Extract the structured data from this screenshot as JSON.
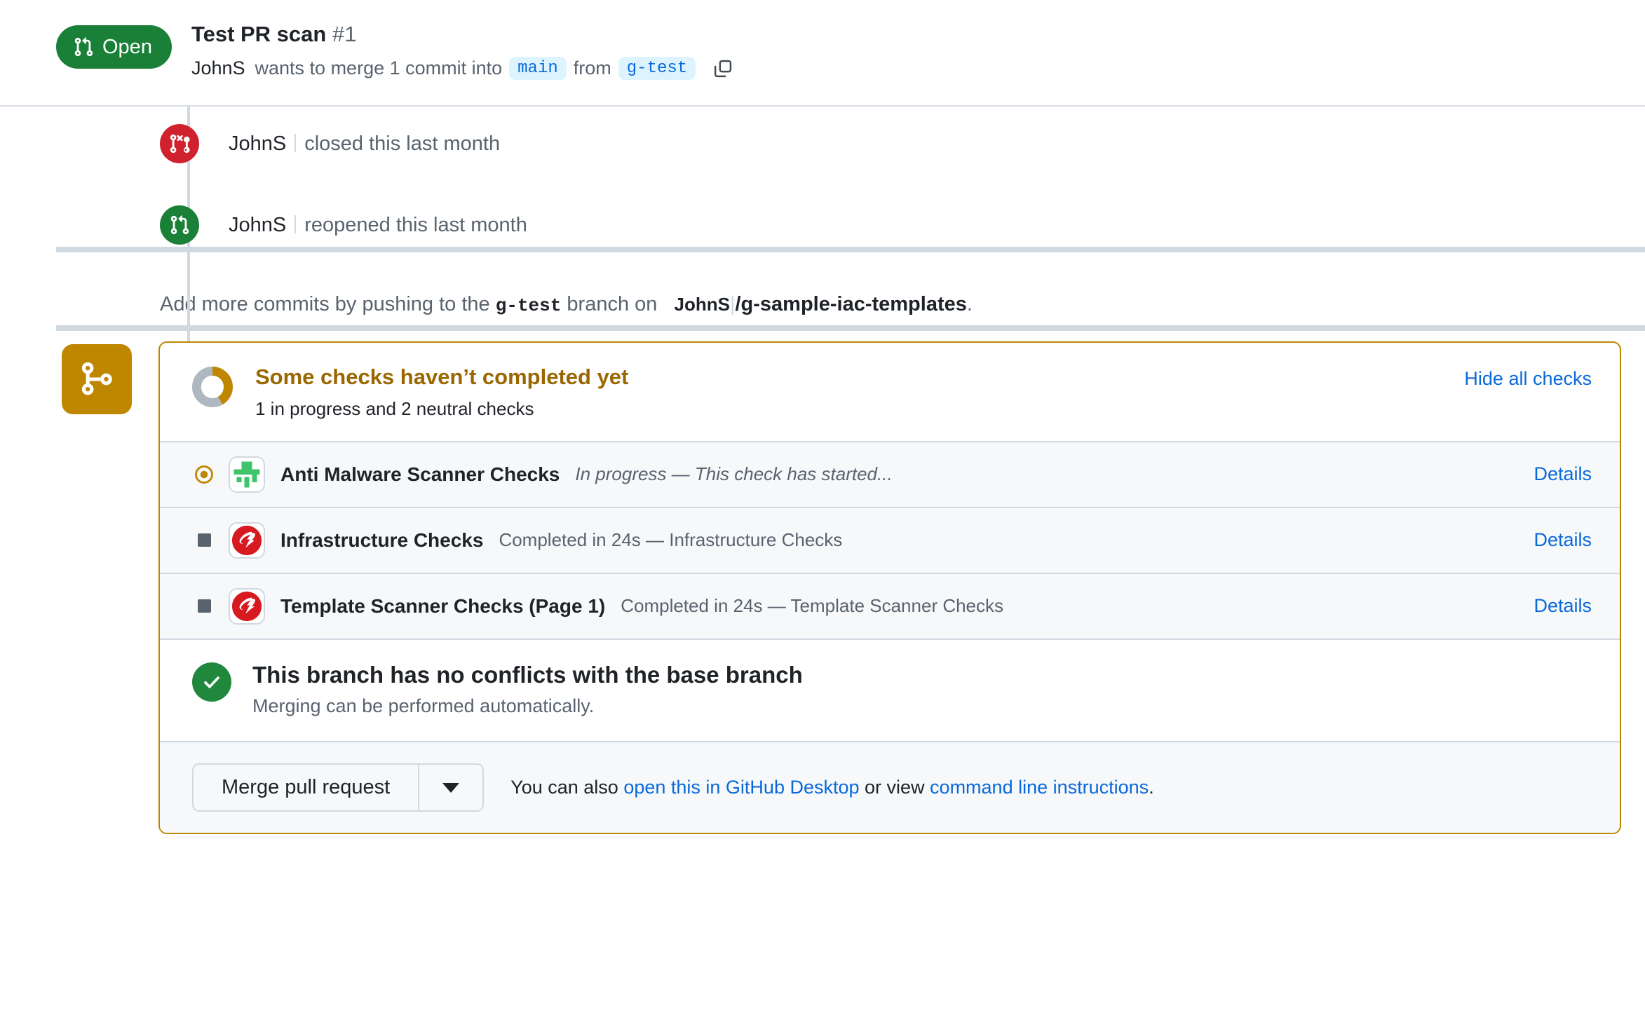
{
  "header": {
    "state_label": "Open",
    "state_icon": "git-pull-request-icon",
    "state_color": "#1a7f37",
    "title": "Test PR scan",
    "number": "#1",
    "author": "JohnS",
    "merge_phrase": "wants to merge 1 commit into",
    "base_branch": "main",
    "from_word": "from",
    "head_branch": "g-test",
    "copy_icon": "copy-icon"
  },
  "timeline": [
    {
      "icon": "pull-request-closed-icon",
      "icon_color": "#cf222e",
      "actor": "JohnS",
      "text": "closed this last month"
    },
    {
      "icon": "pull-request-reopened-icon",
      "icon_color": "#1a7f37",
      "actor": "JohnS",
      "text": "reopened this last month"
    }
  ],
  "add_commits": {
    "prefix": "Add more commits by pushing to the",
    "branch": "g-test",
    "middle": "branch on",
    "repo_owner": "JohnS",
    "repo_name": "/g-sample-iac-templates",
    "suffix": "."
  },
  "merge_box": {
    "side_icon": "git-merge-icon",
    "accent_color": "#bf8700",
    "checks_summary": {
      "progress_icon": "donut-progress-icon",
      "title": "Some checks haven’t completed yet",
      "subtitle": "1 in progress and 2 neutral checks",
      "hide_link": "Hide all checks"
    },
    "checks": [
      {
        "status_icon": "in-progress-dot-icon",
        "status": "in_progress",
        "avatar": "anti-malware-scanner-app-avatar",
        "name": "Anti Malware Scanner Checks",
        "description": "In progress — This check has started...",
        "description_italic": true,
        "details_label": "Details"
      },
      {
        "status_icon": "neutral-square-icon",
        "status": "neutral",
        "avatar": "trend-micro-app-avatar",
        "name": "Infrastructure Checks",
        "description": "Completed in 24s — Infrastructure Checks",
        "description_italic": false,
        "details_label": "Details"
      },
      {
        "status_icon": "neutral-square-icon",
        "status": "neutral",
        "avatar": "trend-micro-app-avatar",
        "name": "Template Scanner Checks (Page 1)",
        "description": "Completed in 24s — Template Scanner Checks",
        "description_italic": false,
        "details_label": "Details"
      }
    ],
    "conflict": {
      "icon": "check-circle-icon",
      "icon_color": "#1f883d",
      "title": "This branch has no conflicts with the base branch",
      "subtitle": "Merging can be performed automatically."
    },
    "footer": {
      "merge_button": "Merge pull request",
      "caret_icon": "chevron-down-icon",
      "note_prefix": "You can also ",
      "desktop_link": "open this in GitHub Desktop",
      "note_middle": " or view ",
      "cli_link": "command line instructions",
      "note_suffix": "."
    }
  }
}
